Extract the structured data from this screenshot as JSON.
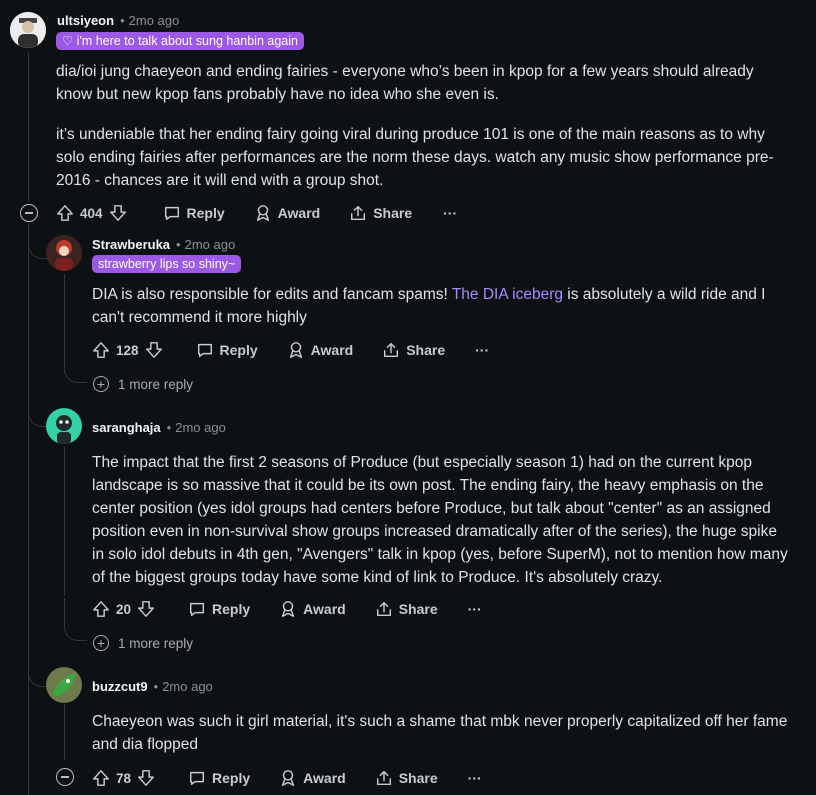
{
  "comments": [
    {
      "author": "ultsiyeon",
      "time": "2mo ago",
      "flair": "♡ i'm here to talk about sung hanbin again",
      "paragraphs": [
        "dia/ioi jung chaeyeon and ending fairies - everyone who’s been in kpop for a few years should already know but new kpop fans probably have no idea who she even is.",
        "it’s undeniable that her ending fairy going viral during produce 101 is one of the main reasons as to why solo ending fairies after performances are the norm these days. watch any music show performance pre-2016 - chances are it will end with a group shot."
      ],
      "votes": "404"
    },
    {
      "author": "Strawberuka",
      "time": "2mo ago",
      "flair": "strawberry lips so shiny~",
      "text_before_link": "DIA is also responsible for edits and fancam spams! ",
      "link_text": "The DIA iceberg",
      "text_after_link": " is absolutely a wild ride and I can't recommend it more highly",
      "votes": "128",
      "more_replies": "1 more reply"
    },
    {
      "author": "saranghaja",
      "time": "2mo ago",
      "text": "The impact that the first 2 seasons of Produce (but especially season 1) had on the current kpop landscape is so massive that it could be its own post. The ending fairy, the heavy emphasis on the center position (yes idol groups had centers before Produce, but talk about \"center\" as an assigned position even in non-survival show groups increased dramatically after of the series), the huge spike in solo idol debuts in 4th gen, \"Avengers\" talk in kpop (yes, before SuperM), not to mention how many of the biggest groups today have some kind of link to Produce. It's absolutely crazy.",
      "votes": "20",
      "more_replies": "1 more reply"
    },
    {
      "author": "buzzcut9",
      "time": "2mo ago",
      "text": "Chaeyeon was such it girl material, it's such a shame that mbk never properly capitalized off her fame and dia flopped",
      "votes": "78"
    }
  ],
  "actions": {
    "reply": "Reply",
    "award": "Award",
    "share": "Share",
    "more": "···"
  },
  "colors": {
    "background": "#0e1113",
    "flair": "#9b59e6",
    "link": "#a78bfa",
    "muted": "#8a8f93"
  }
}
